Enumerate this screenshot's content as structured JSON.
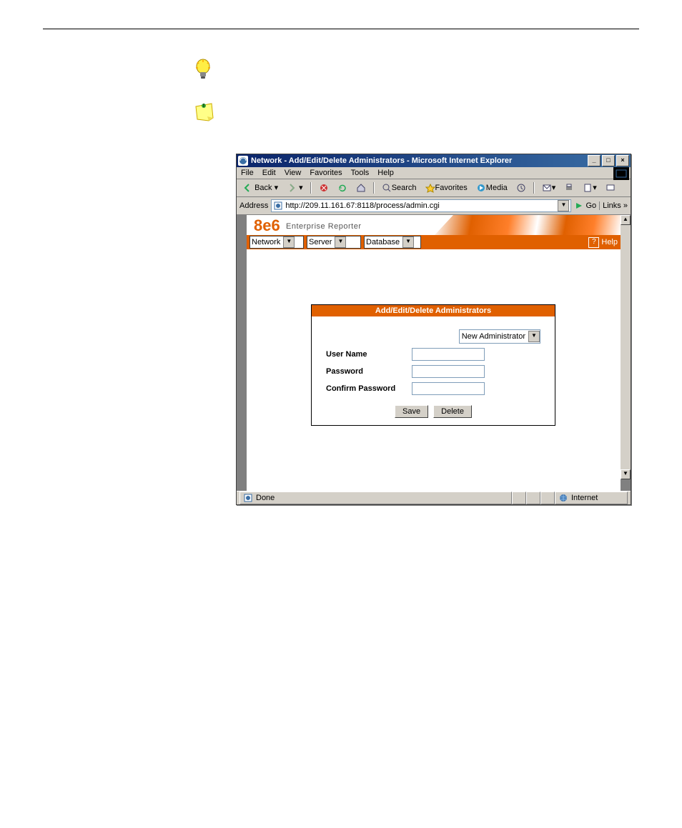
{
  "browser": {
    "title": "Network - Add/Edit/Delete Administrators - Microsoft Internet Explorer",
    "menus": [
      "File",
      "Edit",
      "View",
      "Favorites",
      "Tools",
      "Help"
    ],
    "toolbar": {
      "back": "Back",
      "search": "Search",
      "favorites": "Favorites",
      "media": "Media"
    },
    "address_label": "Address",
    "address_value": "http://209.11.161.67:8118/process/admin.cgi",
    "go": "Go",
    "links": "Links"
  },
  "app": {
    "logo_main": "8e6",
    "logo_sub": "Enterprise Reporter",
    "nav": {
      "network": "Network",
      "server": "Server",
      "database": "Database",
      "help": "Help"
    },
    "form": {
      "header": "Add/Edit/Delete Administrators",
      "selector": "New Administrator",
      "labels": {
        "username": "User Name",
        "password": "Password",
        "confirm": "Confirm Password"
      },
      "buttons": {
        "save": "Save",
        "delete": "Delete"
      }
    }
  },
  "status": {
    "done": "Done",
    "zone": "Internet"
  }
}
